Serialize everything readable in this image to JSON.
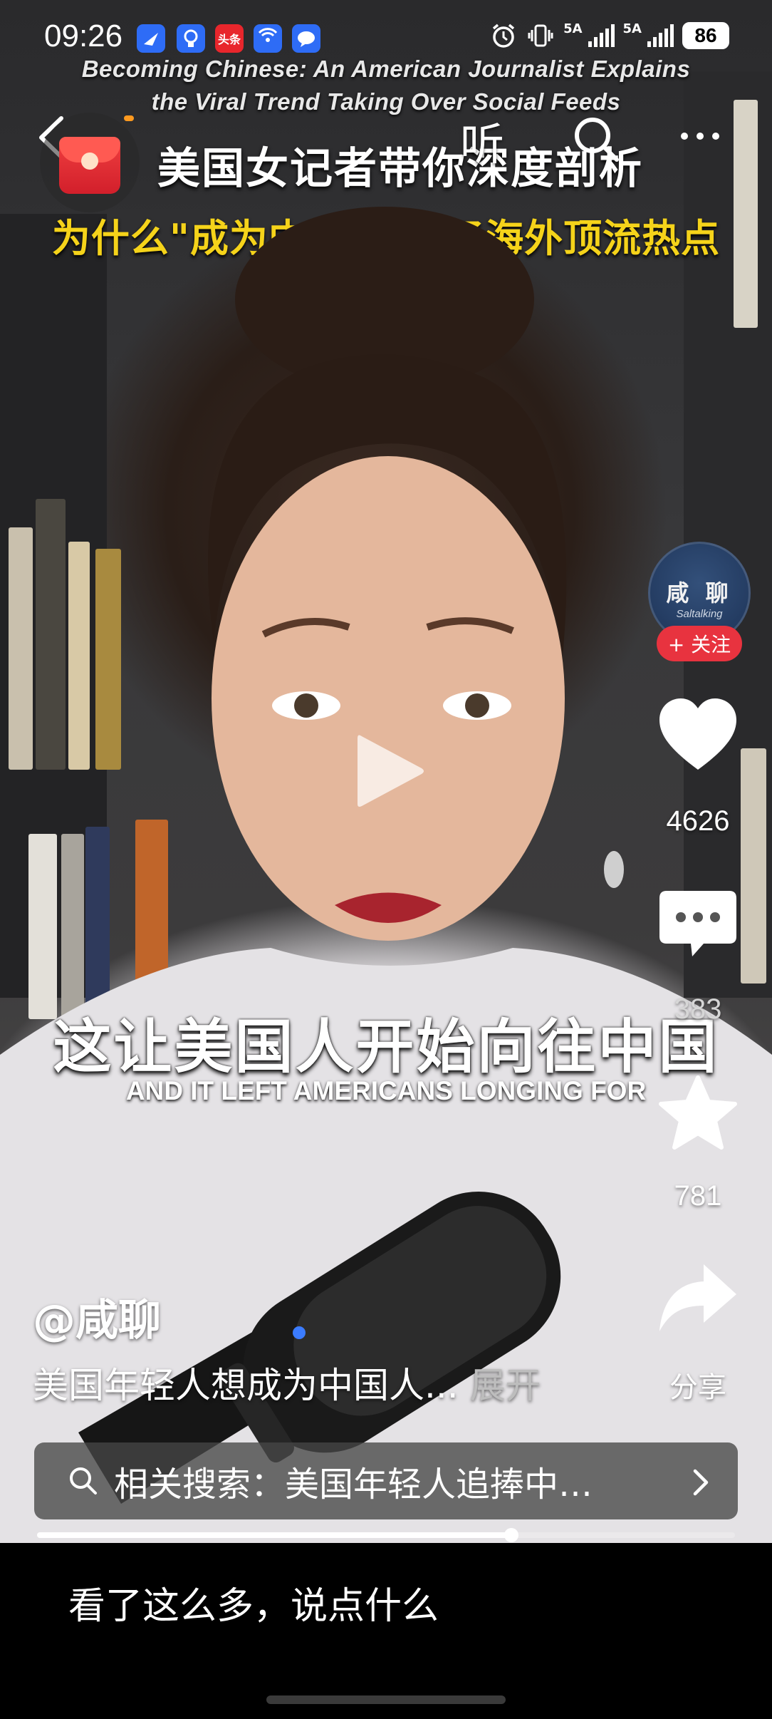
{
  "status_bar": {
    "time": "09:26",
    "network_1": "5A",
    "network_2": "5A",
    "battery": "86",
    "notification_icons": [
      "feishu-icon",
      "lightbulb-icon",
      "toutiao-icon",
      "hotspot-icon",
      "message-icon"
    ],
    "toutiao_label": "头条"
  },
  "video": {
    "title_en_line1": "Becoming Chinese: An American Journalist Explains",
    "title_en_line2": "the Viral Trend Taking Over Social Feeds",
    "title_cn_line1": "美国女记者带你深度剖析",
    "title_cn_line2": "为什么\"成为中国人\"成了海外顶流热点",
    "subtitle_cn": "这让美国人开始向往中国",
    "subtitle_en": "AND IT LEFT AMERICANS LONGING FOR",
    "is_paused": true,
    "progress_fraction": 0.68
  },
  "top_bar": {
    "listen_label": "听"
  },
  "author": {
    "avatar_cn": "咸 聊",
    "avatar_en": "Saltalking",
    "follow_label": "+ 关注",
    "handle": "@咸聊"
  },
  "actions": {
    "likes": "4626",
    "comments": "383",
    "favorites": "781",
    "share_label": "分享"
  },
  "description": {
    "text": "美国年轻人想成为中国人...",
    "expand_label": "展开"
  },
  "related_search": {
    "text": "相关搜索：美国年轻人追捧中…"
  },
  "comment_bar": {
    "placeholder": "看了这么多，说点什么"
  },
  "colors": {
    "follow_red": "#e8333f",
    "title_yellow": "#f5d31a",
    "avatar_blue": "#1d3357"
  }
}
